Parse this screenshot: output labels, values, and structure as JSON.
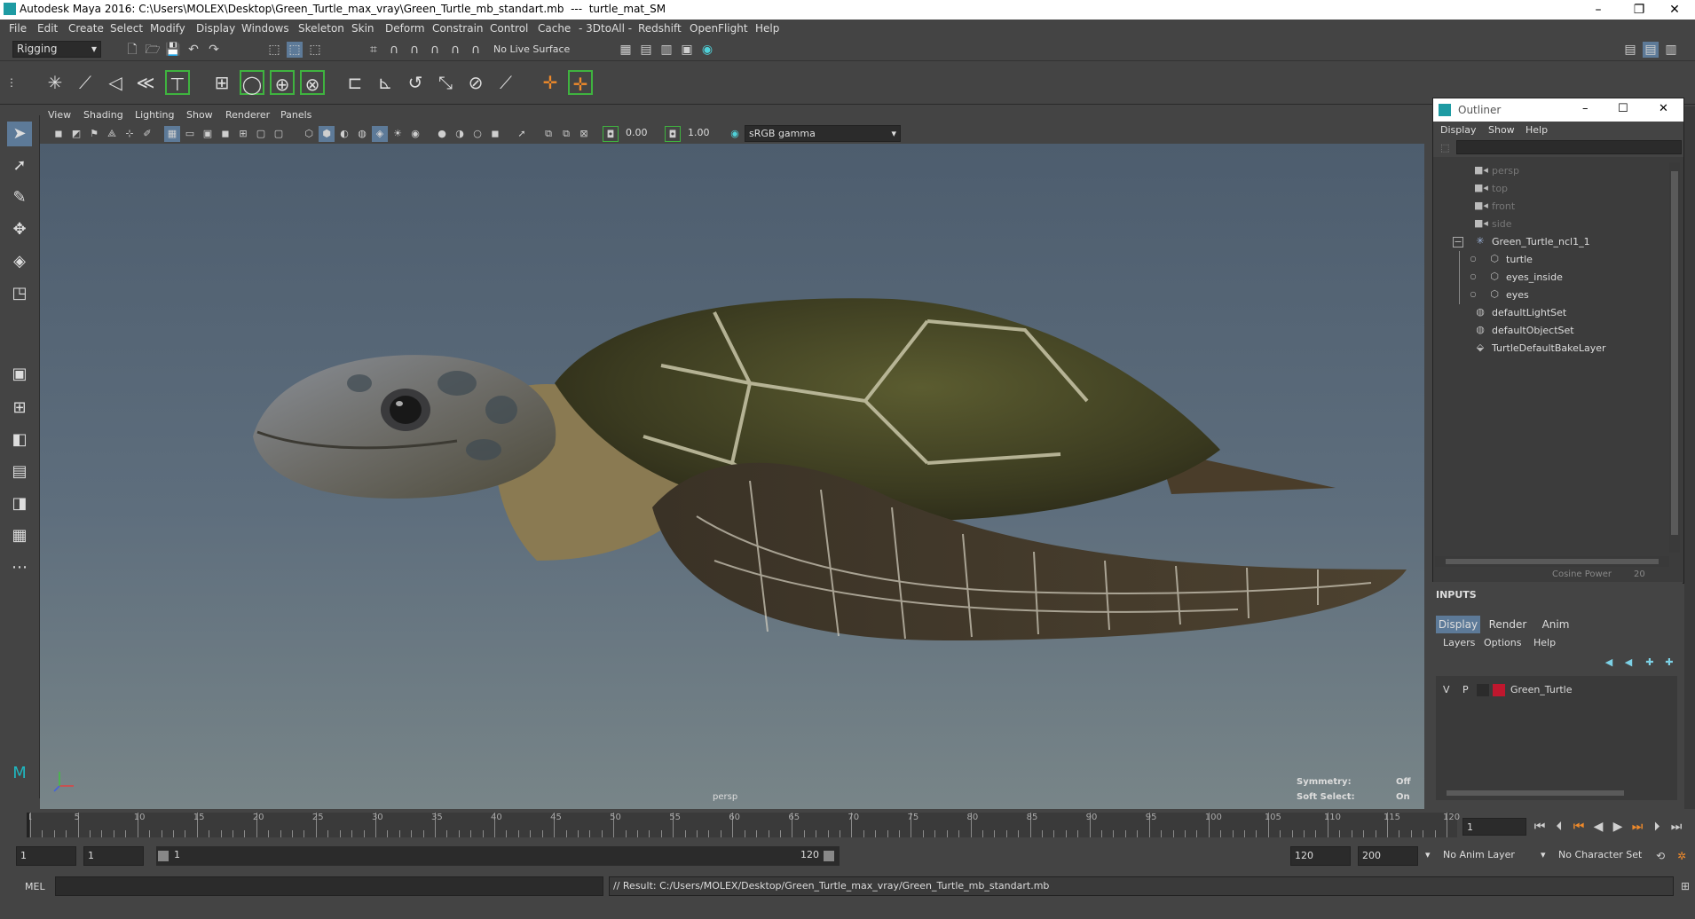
{
  "window": {
    "title": "Autodesk Maya 2016: C:\\Users\\MOLEX\\Desktop\\Green_Turtle_max_vray\\Green_Turtle_mb_standart.mb  ---  turtle_mat_SM",
    "min": "–",
    "restore": "❐",
    "close": "✕"
  },
  "menubar": {
    "items": [
      "File",
      "Edit",
      "Create",
      "Select",
      "Modify",
      "Display",
      "Windows",
      "Skeleton",
      "Skin",
      "Deform",
      "Constrain",
      "Control",
      "Cache",
      "- 3DtoAll -",
      "Redshift",
      "OpenFlight",
      "Help"
    ]
  },
  "statusline": {
    "mode": "Rigging",
    "live_surface": "No Live Surface"
  },
  "panel": {
    "menus": [
      "View",
      "Shading",
      "Lighting",
      "Show",
      "Renderer",
      "Panels"
    ],
    "exposure": "0.00",
    "gamma": "1.00",
    "color_space": "sRGB gamma",
    "camera_label": "persp",
    "symmetry_label": "Symmetry:",
    "symmetry_value": "Off",
    "soft_select_label": "Soft Select:",
    "soft_select_value": "On"
  },
  "outliner": {
    "title": "Outliner",
    "menus": [
      "Display",
      "Show",
      "Help"
    ],
    "rows": [
      {
        "label": "persp",
        "icon": "camera-icon",
        "dim": true
      },
      {
        "label": "top",
        "icon": "camera-icon",
        "dim": true
      },
      {
        "label": "front",
        "icon": "camera-icon",
        "dim": true
      },
      {
        "label": "side",
        "icon": "camera-icon",
        "dim": true
      },
      {
        "label": "Green_Turtle_ncl1_1",
        "icon": "joint-icon",
        "dim": false
      },
      {
        "label": "turtle",
        "icon": "mesh-icon",
        "dim": false
      },
      {
        "label": "eyes_inside",
        "icon": "mesh-icon",
        "dim": false
      },
      {
        "label": "eyes",
        "icon": "mesh-icon",
        "dim": false
      },
      {
        "label": "defaultLightSet",
        "icon": "set-icon",
        "dim": false
      },
      {
        "label": "defaultObjectSet",
        "icon": "set-icon",
        "dim": false
      },
      {
        "label": "TurtleDefaultBakeLayer",
        "icon": "bake-layer-icon",
        "dim": false
      }
    ],
    "behind_text": "Cosine Power",
    "behind_value": "20"
  },
  "layer_editor": {
    "inputs_label": "INPUTS",
    "tabs": [
      "Display",
      "Render",
      "Anim"
    ],
    "menus": [
      "Layers",
      "Options",
      "Help"
    ],
    "layer": {
      "v": "V",
      "p": "P",
      "name": "Green_Turtle",
      "color": "#c0172e"
    }
  },
  "timeline": {
    "ticks": [
      1,
      5,
      10,
      15,
      20,
      25,
      30,
      35,
      40,
      45,
      50,
      55,
      60,
      65,
      70,
      75,
      80,
      85,
      90,
      95,
      100,
      105,
      110,
      115,
      120
    ],
    "current_frame": "1"
  },
  "range": {
    "start": "1",
    "anim_start": "1",
    "slider_start": "1",
    "slider_end": "120",
    "anim_end": "120",
    "end": "200",
    "anim_layer": "No Anim Layer",
    "char_set": "No Character Set"
  },
  "command": {
    "lang": "MEL",
    "result": "// Result: C:/Users/MOLEX/Desktop/Green_Turtle_max_vray/Green_Turtle_mb_standart.mb"
  }
}
